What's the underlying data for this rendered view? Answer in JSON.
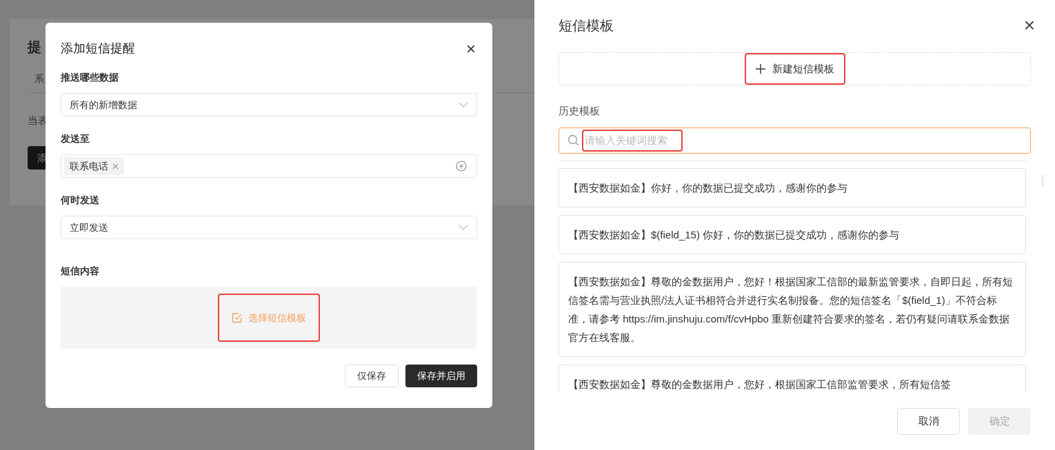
{
  "background_page": {
    "title": "提",
    "tab": "系",
    "description": "当表",
    "button": "添"
  },
  "add_sms_modal": {
    "title": "添加短信提醒",
    "close": "×",
    "sections": [
      {
        "kind": "select",
        "label": "推送哪些数据",
        "value": "所有的新增数据"
      },
      {
        "kind": "tags",
        "label": "发送至",
        "tags": [
          "联系电话"
        ]
      },
      {
        "kind": "select",
        "label": "何时发送",
        "value": "立即发送"
      },
      {
        "kind": "content",
        "label": "短信内容",
        "action": "选择短信模板",
        "highlighted": true
      }
    ],
    "buttons": [
      {
        "label": "仅保存",
        "primary": false
      },
      {
        "label": "保存并启用",
        "primary": true
      }
    ]
  },
  "template_drawer": {
    "title": "短信模板",
    "close": "×",
    "new_button": {
      "label": "新建短信模板",
      "highlighted": true
    },
    "history_label": "历史模板",
    "search": {
      "placeholder": "请输入关键词搜索",
      "focused": true,
      "highlighted": true
    },
    "templates": [
      "【西安数据如金】你好，你的数据已提交成功，感谢你的参与",
      "【西安数据如金】$(field_15) 你好，你的数据已提交成功，感谢你的参与",
      "【西安数据如金】尊敬的金数据用户，您好！根据国家工信部的最新监管要求，自即日起，所有短信签名需与营业执照/法人证书相符合并进行实名制报备。您的短信签名「$(field_1)」不符合标准，请参考 https://im.jinshuju.com/f/cvHpbo 重新创建符合要求的签名，若仍有疑问请联系金数据官方在线客服。",
      "【西安数据如金】尊敬的金数据用户，您好，根据国家工信部监管要求，所有短信签"
    ],
    "buttons": [
      {
        "label": "取消",
        "disabled": false
      },
      {
        "label": "确定",
        "disabled": true
      }
    ]
  }
}
